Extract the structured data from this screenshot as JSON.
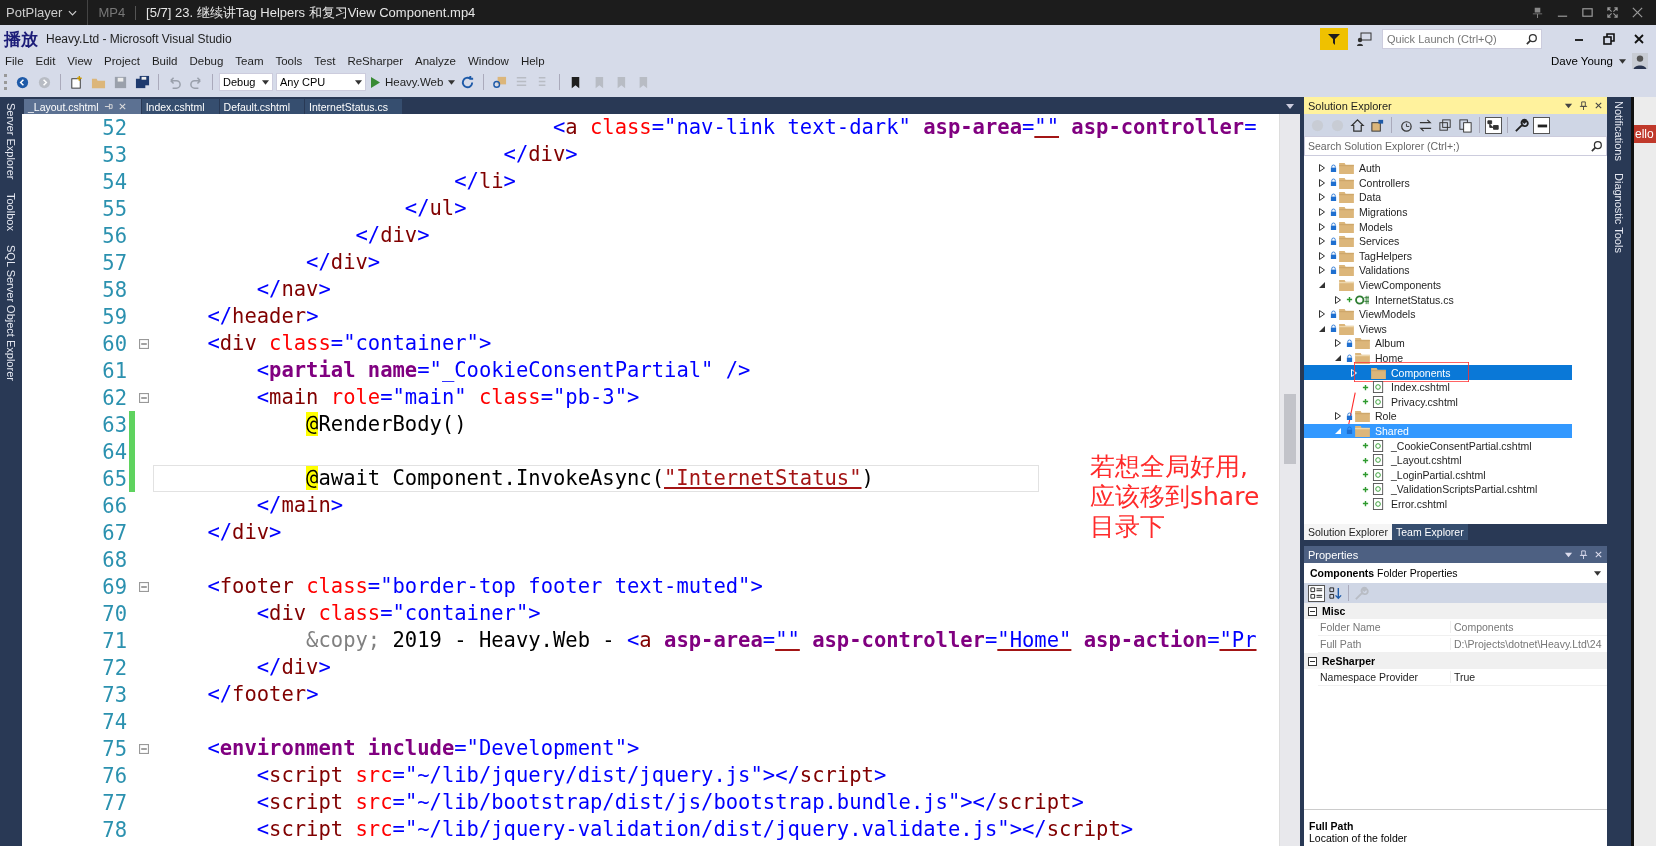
{
  "player_bar": {
    "app": "PotPlayer",
    "format": "MP4",
    "title": "[5/7] 23. 继续讲Tag Helpers 和复习View Component.mp4"
  },
  "osd_label": "播放",
  "window": {
    "title": "Heavy.Ltd - Microsoft Visual Studio",
    "quick_launch": {
      "placeholder": "Quick Launch (Ctrl+Q)"
    },
    "user": "Dave Young"
  },
  "menu": [
    "File",
    "Edit",
    "View",
    "Project",
    "Build",
    "Debug",
    "Team",
    "Tools",
    "Test",
    "ReSharper",
    "Analyze",
    "Window",
    "Help"
  ],
  "toolbar": {
    "configuration": "Debug",
    "platform": "Any CPU",
    "start": "Heavy.Web"
  },
  "left_tool_tabs": [
    "Server Explorer",
    "Toolbox",
    "SQL Server Object Explorer"
  ],
  "right_tool_tabs": [
    "Notifications",
    "Diagnostic Tools"
  ],
  "tabs": [
    {
      "label": "_Layout.cshtml",
      "selected": true
    },
    {
      "label": "Index.cshtml",
      "selected": false
    },
    {
      "label": "Default.cshtml",
      "selected": false
    },
    {
      "label": "InternetStatus.cs",
      "selected": false
    }
  ],
  "editor": {
    "lines": [
      {
        "number": "52",
        "changed": false,
        "fold": false,
        "current": false,
        "tokens": [
          {
            "kind": "delim",
            "text": "                                <"
          },
          {
            "kind": "tag",
            "text": "a"
          },
          {
            "kind": "attr",
            "text": " class"
          },
          {
            "kind": "delim",
            "text": "="
          },
          {
            "kind": "value",
            "text": "\"nav-link text-dark\""
          },
          {
            "kind": "helper",
            "text": " asp-area"
          },
          {
            "kind": "delim",
            "text": "="
          },
          {
            "kind": "link",
            "text": "\"\""
          },
          {
            "kind": "helper",
            "text": " asp-controller"
          },
          {
            "kind": "delim",
            "text": "="
          }
        ]
      },
      {
        "number": "53",
        "changed": false,
        "fold": false,
        "current": false,
        "tokens": [
          {
            "kind": "delim",
            "text": "                            </"
          },
          {
            "kind": "tag",
            "text": "div"
          },
          {
            "kind": "delim",
            "text": ">"
          }
        ]
      },
      {
        "number": "54",
        "changed": false,
        "fold": false,
        "current": false,
        "tokens": [
          {
            "kind": "delim",
            "text": "                        </"
          },
          {
            "kind": "tag",
            "text": "li"
          },
          {
            "kind": "delim",
            "text": ">"
          }
        ]
      },
      {
        "number": "55",
        "changed": false,
        "fold": false,
        "current": false,
        "tokens": [
          {
            "kind": "delim",
            "text": "                    </"
          },
          {
            "kind": "tag",
            "text": "ul"
          },
          {
            "kind": "delim",
            "text": ">"
          }
        ]
      },
      {
        "number": "56",
        "changed": false,
        "fold": false,
        "current": false,
        "tokens": [
          {
            "kind": "delim",
            "text": "                </"
          },
          {
            "kind": "tag",
            "text": "div"
          },
          {
            "kind": "delim",
            "text": ">"
          }
        ]
      },
      {
        "number": "57",
        "changed": false,
        "fold": false,
        "current": false,
        "tokens": [
          {
            "kind": "delim",
            "text": "            </"
          },
          {
            "kind": "tag",
            "text": "div"
          },
          {
            "kind": "delim",
            "text": ">"
          }
        ]
      },
      {
        "number": "58",
        "changed": false,
        "fold": false,
        "current": false,
        "tokens": [
          {
            "kind": "delim",
            "text": "        </"
          },
          {
            "kind": "tag",
            "text": "nav"
          },
          {
            "kind": "delim",
            "text": ">"
          }
        ]
      },
      {
        "number": "59",
        "changed": false,
        "fold": false,
        "current": false,
        "tokens": [
          {
            "kind": "delim",
            "text": "    </"
          },
          {
            "kind": "tag",
            "text": "header"
          },
          {
            "kind": "delim",
            "text": ">"
          }
        ]
      },
      {
        "number": "60",
        "changed": false,
        "fold": true,
        "current": false,
        "tokens": [
          {
            "kind": "delim",
            "text": "    <"
          },
          {
            "kind": "tag",
            "text": "div"
          },
          {
            "kind": "attr",
            "text": " class"
          },
          {
            "kind": "delim",
            "text": "="
          },
          {
            "kind": "value",
            "text": "\"container\""
          },
          {
            "kind": "delim",
            "text": ">"
          }
        ]
      },
      {
        "number": "61",
        "changed": false,
        "fold": false,
        "current": false,
        "tokens": [
          {
            "kind": "delim",
            "text": "        <"
          },
          {
            "kind": "helper",
            "text": "partial"
          },
          {
            "kind": "helper",
            "text": " name"
          },
          {
            "kind": "delim",
            "text": "="
          },
          {
            "kind": "value",
            "text": "\"_CookieConsentPartial\""
          },
          {
            "kind": "delim",
            "text": " />"
          }
        ]
      },
      {
        "number": "62",
        "changed": false,
        "fold": true,
        "current": false,
        "tokens": [
          {
            "kind": "delim",
            "text": "        <"
          },
          {
            "kind": "tag",
            "text": "main"
          },
          {
            "kind": "attr",
            "text": " role"
          },
          {
            "kind": "delim",
            "text": "="
          },
          {
            "kind": "value",
            "text": "\"main\""
          },
          {
            "kind": "attr",
            "text": " class"
          },
          {
            "kind": "delim",
            "text": "="
          },
          {
            "kind": "value",
            "text": "\"pb-3\""
          },
          {
            "kind": "delim",
            "text": ">"
          }
        ]
      },
      {
        "number": "63",
        "changed": true,
        "fold": false,
        "current": false,
        "tokens": [
          {
            "kind": "razor",
            "text": "            @"
          },
          {
            "kind": "plain",
            "text": "RenderBody()"
          }
        ]
      },
      {
        "number": "64",
        "changed": true,
        "fold": false
      },
      {
        "number": "65",
        "changed": true,
        "fold": false,
        "current": true,
        "tokens": [
          {
            "kind": "razor",
            "text": "            @"
          },
          {
            "kind": "plain",
            "text": "await Component.InvokeAsync("
          },
          {
            "kind": "string",
            "text": "\"InternetStatus\""
          },
          {
            "kind": "plain",
            "text": ")"
          }
        ]
      },
      {
        "number": "66",
        "changed": false,
        "fold": false,
        "current": false,
        "tokens": [
          {
            "kind": "delim",
            "text": "        </"
          },
          {
            "kind": "tag",
            "text": "main"
          },
          {
            "kind": "delim",
            "text": ">"
          }
        ]
      },
      {
        "number": "67",
        "changed": false,
        "fold": false,
        "current": false,
        "tokens": [
          {
            "kind": "delim",
            "text": "    </"
          },
          {
            "kind": "tag",
            "text": "div"
          },
          {
            "kind": "delim",
            "text": ">"
          }
        ]
      },
      {
        "number": "68",
        "changed": false,
        "fold": false
      },
      {
        "number": "69",
        "changed": false,
        "fold": true,
        "current": false,
        "tokens": [
          {
            "kind": "delim",
            "text": "    <"
          },
          {
            "kind": "tag",
            "text": "footer"
          },
          {
            "kind": "attr",
            "text": " class"
          },
          {
            "kind": "delim",
            "text": "="
          },
          {
            "kind": "value",
            "text": "\"border-top footer text-muted\""
          },
          {
            "kind": "delim",
            "text": ">"
          }
        ]
      },
      {
        "number": "70",
        "changed": false,
        "fold": false,
        "current": false,
        "tokens": [
          {
            "kind": "delim",
            "text": "        <"
          },
          {
            "kind": "tag",
            "text": "div"
          },
          {
            "kind": "attr",
            "text": " class"
          },
          {
            "kind": "delim",
            "text": "="
          },
          {
            "kind": "value",
            "text": "\"container\""
          },
          {
            "kind": "delim",
            "text": ">"
          }
        ]
      },
      {
        "number": "71",
        "changed": false,
        "fold": false,
        "current": false,
        "tokens": [
          {
            "kind": "muted",
            "text": "            &copy;"
          },
          {
            "kind": "plain",
            "text": " 2019 - Heavy.Web - "
          },
          {
            "kind": "delim",
            "text": "<"
          },
          {
            "kind": "tag",
            "text": "a"
          },
          {
            "kind": "helper",
            "text": " asp-area"
          },
          {
            "kind": "delim",
            "text": "="
          },
          {
            "kind": "link",
            "text": "\"\""
          },
          {
            "kind": "helper",
            "text": " asp-controller"
          },
          {
            "kind": "delim",
            "text": "="
          },
          {
            "kind": "link",
            "text": "\"Home\""
          },
          {
            "kind": "helper",
            "text": " asp-action"
          },
          {
            "kind": "delim",
            "text": "="
          },
          {
            "kind": "link",
            "text": "\"Pr"
          }
        ]
      },
      {
        "number": "72",
        "changed": false,
        "fold": false,
        "current": false,
        "tokens": [
          {
            "kind": "delim",
            "text": "        </"
          },
          {
            "kind": "tag",
            "text": "div"
          },
          {
            "kind": "delim",
            "text": ">"
          }
        ]
      },
      {
        "number": "73",
        "changed": false,
        "fold": false,
        "current": false,
        "tokens": [
          {
            "kind": "delim",
            "text": "    </"
          },
          {
            "kind": "tag",
            "text": "footer"
          },
          {
            "kind": "delim",
            "text": ">"
          }
        ]
      },
      {
        "number": "74",
        "changed": false,
        "fold": false
      },
      {
        "number": "75",
        "changed": false,
        "fold": true,
        "current": false,
        "tokens": [
          {
            "kind": "delim",
            "text": "    <"
          },
          {
            "kind": "helper",
            "text": "environment"
          },
          {
            "kind": "helper",
            "text": " include"
          },
          {
            "kind": "delim",
            "text": "="
          },
          {
            "kind": "value",
            "text": "\"Development\""
          },
          {
            "kind": "delim",
            "text": ">"
          }
        ]
      },
      {
        "number": "76",
        "changed": false,
        "fold": false,
        "current": false,
        "tokens": [
          {
            "kind": "delim",
            "text": "        <"
          },
          {
            "kind": "tag",
            "text": "script"
          },
          {
            "kind": "attr",
            "text": " src"
          },
          {
            "kind": "delim",
            "text": "="
          },
          {
            "kind": "value",
            "text": "\"~/lib/jquery/dist/jquery.js\""
          },
          {
            "kind": "delim",
            "text": "></"
          },
          {
            "kind": "tag",
            "text": "script"
          },
          {
            "kind": "delim",
            "text": ">"
          }
        ]
      },
      {
        "number": "77",
        "changed": false,
        "fold": false,
        "current": false,
        "tokens": [
          {
            "kind": "delim",
            "text": "        <"
          },
          {
            "kind": "tag",
            "text": "script"
          },
          {
            "kind": "attr",
            "text": " src"
          },
          {
            "kind": "delim",
            "text": "="
          },
          {
            "kind": "value",
            "text": "\"~/lib/bootstrap/dist/js/bootstrap.bundle.js\""
          },
          {
            "kind": "delim",
            "text": "></"
          },
          {
            "kind": "tag",
            "text": "script"
          },
          {
            "kind": "delim",
            "text": ">"
          }
        ]
      },
      {
        "number": "78",
        "changed": false,
        "fold": false,
        "current": false,
        "tokens": [
          {
            "kind": "delim",
            "text": "        <"
          },
          {
            "kind": "tag",
            "text": "script"
          },
          {
            "kind": "attr",
            "text": " src"
          },
          {
            "kind": "delim",
            "text": "="
          },
          {
            "kind": "value",
            "text": "\"~/lib/jquery-validation/dist/jquery.validate.js\""
          },
          {
            "kind": "delim",
            "text": "></"
          },
          {
            "kind": "tag",
            "text": "script"
          },
          {
            "kind": "delim",
            "text": ">"
          }
        ]
      }
    ]
  },
  "annotation": {
    "lines": [
      "若想全局好用,",
      "应该移到share",
      "目录下"
    ]
  },
  "solution_explorer": {
    "title": "Solution Explorer",
    "search": {
      "placeholder": "Search Solution Explorer (Ctrl+;)"
    },
    "tree": [
      {
        "label": "Auth",
        "kind": "folder",
        "locked": true,
        "added": false,
        "expanded": false,
        "selected": false,
        "drop_target": false
      },
      {
        "label": "Controllers",
        "kind": "folder",
        "locked": true,
        "added": false,
        "expanded": false,
        "selected": false,
        "drop_target": false
      },
      {
        "label": "Data",
        "kind": "folder",
        "locked": true,
        "added": false,
        "expanded": false,
        "selected": false,
        "drop_target": false
      },
      {
        "label": "Migrations",
        "kind": "folder",
        "locked": true,
        "added": false,
        "expanded": false,
        "selected": false,
        "drop_target": false
      },
      {
        "label": "Models",
        "kind": "folder",
        "locked": true,
        "added": false,
        "expanded": false,
        "selected": false,
        "drop_target": false
      },
      {
        "label": "Services",
        "kind": "folder",
        "locked": true,
        "added": false,
        "expanded": false,
        "selected": false,
        "drop_target": false
      },
      {
        "label": "TagHelpers",
        "kind": "folder",
        "locked": true,
        "added": false,
        "expanded": false,
        "selected": false,
        "drop_target": false
      },
      {
        "label": "Validations",
        "kind": "folder",
        "locked": true,
        "added": false,
        "expanded": false,
        "selected": false,
        "drop_target": false
      },
      {
        "label": "ViewComponents",
        "kind": "folder",
        "locked": false,
        "added": false,
        "expanded": true,
        "selected": false,
        "drop_target": false,
        "children": [
          {
            "label": "InternetStatus.cs",
            "kind": "cs",
            "locked": false,
            "added": true,
            "expanded": false,
            "selected": false,
            "drop_target": false
          }
        ]
      },
      {
        "label": "ViewModels",
        "kind": "folder",
        "locked": true,
        "added": false,
        "expanded": false,
        "selected": false,
        "drop_target": false
      },
      {
        "label": "Views",
        "kind": "folder",
        "locked": true,
        "added": false,
        "expanded": true,
        "selected": false,
        "drop_target": false,
        "children": [
          {
            "label": "Album",
            "kind": "folder",
            "locked": true,
            "added": false,
            "expanded": false,
            "selected": false,
            "drop_target": false
          },
          {
            "label": "Home",
            "kind": "folder",
            "locked": true,
            "added": false,
            "expanded": true,
            "selected": false,
            "drop_target": false,
            "children": [
              {
                "label": "Components",
                "kind": "folder",
                "locked": false,
                "added": false,
                "expanded": false,
                "selected": true,
                "drop_target": false
              },
              {
                "label": "Index.cshtml",
                "kind": "cshtml",
                "locked": false,
                "added": true,
                "selected": false,
                "drop_target": false
              },
              {
                "label": "Privacy.cshtml",
                "kind": "cshtml",
                "locked": false,
                "added": true,
                "selected": false,
                "drop_target": false
              }
            ]
          },
          {
            "label": "Role",
            "kind": "folder",
            "locked": true,
            "added": false,
            "expanded": false,
            "selected": false,
            "drop_target": false
          },
          {
            "label": "Shared",
            "kind": "folder",
            "locked": true,
            "added": false,
            "expanded": true,
            "selected": false,
            "drop_target": true,
            "children": [
              {
                "label": "_CookieConsentPartial.cshtml",
                "kind": "cshtml",
                "locked": false,
                "added": true,
                "selected": false,
                "drop_target": false
              },
              {
                "label": "_Layout.cshtml",
                "kind": "cshtml",
                "locked": false,
                "added": true,
                "selected": false,
                "drop_target": false
              },
              {
                "label": "_LoginPartial.cshtml",
                "kind": "cshtml",
                "locked": false,
                "added": true,
                "selected": false,
                "drop_target": false
              },
              {
                "label": "_ValidationScriptsPartial.cshtml",
                "kind": "cshtml",
                "locked": false,
                "added": true,
                "selected": false,
                "drop_target": false
              },
              {
                "label": "Error.cshtml",
                "kind": "cshtml",
                "locked": false,
                "added": true,
                "selected": false,
                "drop_target": false
              }
            ]
          }
        ]
      }
    ],
    "bottom_tabs": [
      {
        "label": "Solution Explorer",
        "selected": true
      },
      {
        "label": "Team Explorer",
        "selected": false
      }
    ]
  },
  "properties": {
    "title": "Properties",
    "object": "**Components** Folder Properties",
    "categories": [
      {
        "name": "Misc",
        "expanded": true,
        "rows": [
          {
            "name": "Folder Name",
            "value": "Components"
          },
          {
            "name": "Full Path",
            "value": "D:\\Projects\\dotnet\\Heavy.Ltd\\24"
          }
        ]
      },
      {
        "name": "ReSharper",
        "expanded": true,
        "rows": [
          {
            "name": "Namespace Provider",
            "value": "True"
          }
        ]
      }
    ],
    "description": {
      "title": "Full Path",
      "text": "Location of the folder"
    }
  },
  "edge_tag": "ello"
}
